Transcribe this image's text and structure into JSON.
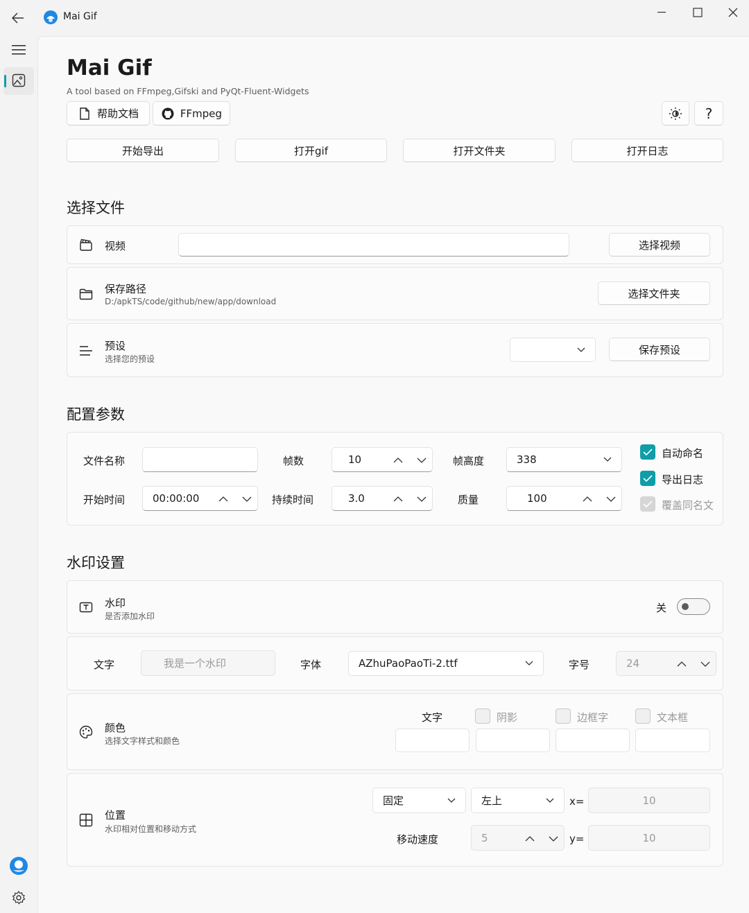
{
  "window": {
    "title": "Mai Gif"
  },
  "header": {
    "title": "Mai Gif",
    "subtitle": "A tool based on FFmpeg,Gifski and PyQt-Fluent-Widgets",
    "help_doc_label": "帮助文档",
    "ffmpeg_label": "FFmpeg",
    "help_label": "?"
  },
  "actions": {
    "start_export": "开始导出",
    "open_gif": "打开gif",
    "open_folder": "打开文件夹",
    "open_log": "打开日志"
  },
  "select_file": {
    "section_title": "选择文件",
    "video_label": "视频",
    "video_value": "",
    "select_video_button": "选择视频",
    "save_path_label": "保存路径",
    "save_path_value": "D:/apkTS/code/github/new/app/download",
    "select_folder_button": "选择文件夹",
    "preset_label": "预设",
    "preset_desc": "选择您的预设",
    "preset_value": "",
    "save_preset_button": "保存预设"
  },
  "config": {
    "section_title": "配置参数",
    "file_name_label": "文件名称",
    "file_name_value": "",
    "frames_label": "帧数",
    "frames_value": "10",
    "frame_height_label": "帧高度",
    "frame_height_value": "338",
    "start_time_label": "开始时间",
    "start_time_value": "00:00:00",
    "duration_label": "持续时间",
    "duration_value": "3.0",
    "quality_label": "质量",
    "quality_value": "100",
    "auto_name_label": "自动命名",
    "auto_name_checked": true,
    "export_log_label": "导出日志",
    "export_log_checked": true,
    "overwrite_label": "覆盖同名文",
    "overwrite_checked": true
  },
  "watermark": {
    "section_title": "水印设置",
    "watermark_label": "水印",
    "watermark_desc": "是否添加水印",
    "toggle_state_label": "关",
    "text_label": "文字",
    "text_placeholder": "我是一个水印",
    "font_label": "字体",
    "font_value": "AZhuPaoPaoTi-2.ttf",
    "font_size_label": "字号",
    "font_size_value": "24",
    "color_label": "颜色",
    "color_desc": "选择文字样式和颜色",
    "color_text_label": "文字",
    "shadow_label": "阴影",
    "outline_label": "边框字",
    "textbox_label": "文本框",
    "position_label": "位置",
    "position_desc": "水印相对位置和移动方式",
    "mode_value": "固定",
    "anchor_value": "左上",
    "x_label": "x=",
    "x_value": "10",
    "move_speed_label": "移动速度",
    "move_speed_value": "5",
    "y_label": "y=",
    "y_value": "10"
  },
  "colors": {
    "accent": "#0f9ea8"
  }
}
